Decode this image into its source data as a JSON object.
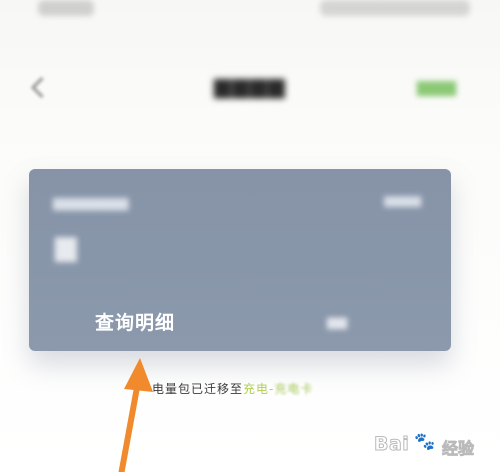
{
  "status_bar": {},
  "nav": {
    "title": "",
    "action": ""
  },
  "card": {
    "detail_label": "查询明细"
  },
  "notice": {
    "prefix": "电量包已迁移至",
    "link1": "充电",
    "separator": "-",
    "link2": "充电卡"
  },
  "watermark": {
    "brand": "Bai",
    "paw": "🐾",
    "suffix": "经验"
  },
  "colors": {
    "card_bg": "#8896aa",
    "accent_green": "#b1cf51",
    "arrow_orange": "#f08a2c",
    "page_bg": "#fbfbf9"
  },
  "icons": {
    "back": "chevron-left-icon",
    "arrow": "orange-pointer-arrow-icon",
    "watermark": "baidu-jingyan-logo-icon"
  }
}
